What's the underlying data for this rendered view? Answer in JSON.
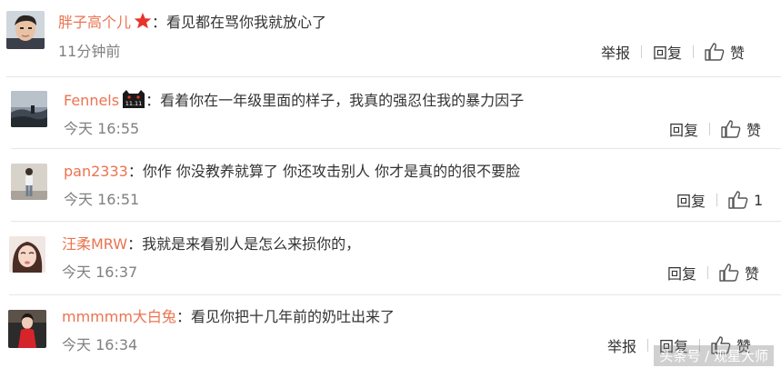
{
  "comments": [
    {
      "username": "胖子高个儿",
      "badge": "star-icon",
      "text": "：看见都在骂你我就放心了",
      "time": "11分钟前",
      "report_label": "举报",
      "reply_label": "回复",
      "like_label": "赞"
    },
    {
      "username": "Fennels",
      "badge": "double-eleven-cat-icon",
      "badge_text": "11.11",
      "text": "：看着你在一年级里面的样子，我真的强忍住我的暴力因子",
      "time": "今天 16:55",
      "reply_label": "回复",
      "like_label": "赞"
    },
    {
      "username": "pan2333",
      "text": "：你作 你没教养就算了 你还攻击别人 你才是真的的很不要脸",
      "time": "今天 16:51",
      "reply_label": "回复",
      "like_label": "1"
    },
    {
      "username": "汪柔MRW",
      "text": "：我就是来看别人是怎么来损你的，",
      "time": "今天 16:37",
      "reply_label": "回复",
      "like_label": "赞"
    },
    {
      "username": "mmmmm大白兔",
      "text": "：看见你把十几年前的奶吐出来了",
      "time": "今天 16:34",
      "report_label": "举报",
      "reply_label": "回复",
      "like_label": "赞"
    }
  ],
  "watermark": "头条号 / 观星大师",
  "colors": {
    "username": "#eb7350",
    "text": "#333333",
    "time": "#808080",
    "divider": "#e6e6e6",
    "star": "#e8332a"
  }
}
